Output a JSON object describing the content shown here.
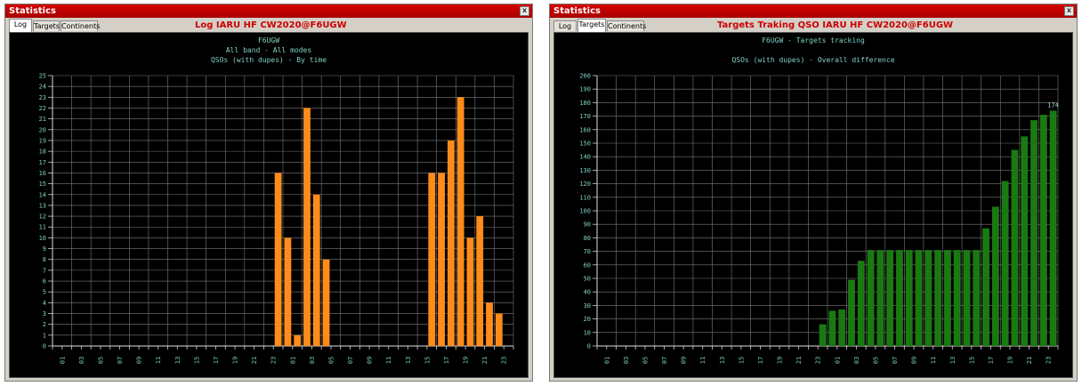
{
  "left_window": {
    "title": "Statistics",
    "close_label": "x",
    "tabs": [
      {
        "label": "Log",
        "active": true
      },
      {
        "label": "Targets",
        "active": false
      },
      {
        "label": "Continents",
        "active": false
      }
    ],
    "header": "Log IARU HF CW2020@F6UGW",
    "subtitle_1": "F6UGW",
    "subtitle_2": "All band - All modes",
    "subtitle_3": "QSOs (with dupes) - By time"
  },
  "right_window": {
    "title": "Statistics",
    "close_label": "x",
    "tabs": [
      {
        "label": "Log",
        "active": false
      },
      {
        "label": "Targets",
        "active": true
      },
      {
        "label": "Continents",
        "active": false
      }
    ],
    "header": "Targets Traking QSO IARU HF CW2020@F6UGW",
    "subtitle_1": "F6UGW - Targets tracking",
    "subtitle_2": "QSOs (with dupes) - Overall difference"
  },
  "chart_data": [
    {
      "type": "bar",
      "title": "QSOs (with dupes) - By time",
      "color": "#ff8c1a",
      "ylim": [
        0,
        25
      ],
      "ytick_step": 1,
      "x_tick_labels": [
        "01",
        "03",
        "05",
        "07",
        "09",
        "11",
        "13",
        "15",
        "17",
        "19",
        "21",
        "23",
        "01",
        "03",
        "05",
        "07",
        "09",
        "11",
        "13",
        "15",
        "17",
        "19",
        "21",
        "23"
      ],
      "grid": true,
      "bars": [
        {
          "slot": 23,
          "value": 16
        },
        {
          "slot": 24,
          "value": 10
        },
        {
          "slot": 25,
          "value": 1
        },
        {
          "slot": 26,
          "value": 22
        },
        {
          "slot": 27,
          "value": 14
        },
        {
          "slot": 28,
          "value": 8
        },
        {
          "slot": 39,
          "value": 16
        },
        {
          "slot": 40,
          "value": 16
        },
        {
          "slot": 41,
          "value": 19
        },
        {
          "slot": 42,
          "value": 23
        },
        {
          "slot": 43,
          "value": 10
        },
        {
          "slot": 44,
          "value": 12
        },
        {
          "slot": 45,
          "value": 4
        },
        {
          "slot": 46,
          "value": 3
        }
      ]
    },
    {
      "type": "bar",
      "title": "QSOs (with dupes) - Overall difference",
      "color": "#1a7a12",
      "ylim": [
        0,
        200
      ],
      "ytick_step": 10,
      "x_tick_labels": [
        "01",
        "03",
        "05",
        "07",
        "09",
        "11",
        "13",
        "15",
        "17",
        "19",
        "21",
        "23",
        "01",
        "03",
        "05",
        "07",
        "09",
        "11",
        "13",
        "15",
        "17",
        "19",
        "21",
        "23"
      ],
      "grid": true,
      "annotation": "174",
      "bars": [
        {
          "slot": 23,
          "value": 16
        },
        {
          "slot": 24,
          "value": 26
        },
        {
          "slot": 25,
          "value": 27
        },
        {
          "slot": 26,
          "value": 49
        },
        {
          "slot": 27,
          "value": 63
        },
        {
          "slot": 28,
          "value": 71
        },
        {
          "slot": 29,
          "value": 71
        },
        {
          "slot": 30,
          "value": 71
        },
        {
          "slot": 31,
          "value": 71
        },
        {
          "slot": 32,
          "value": 71
        },
        {
          "slot": 33,
          "value": 71
        },
        {
          "slot": 34,
          "value": 71
        },
        {
          "slot": 35,
          "value": 71
        },
        {
          "slot": 36,
          "value": 71
        },
        {
          "slot": 37,
          "value": 71
        },
        {
          "slot": 38,
          "value": 71
        },
        {
          "slot": 39,
          "value": 71
        },
        {
          "slot": 40,
          "value": 87
        },
        {
          "slot": 41,
          "value": 103
        },
        {
          "slot": 42,
          "value": 122
        },
        {
          "slot": 43,
          "value": 145
        },
        {
          "slot": 44,
          "value": 155
        },
        {
          "slot": 45,
          "value": 167
        },
        {
          "slot": 46,
          "value": 171
        },
        {
          "slot": 47,
          "value": 174
        }
      ]
    }
  ]
}
